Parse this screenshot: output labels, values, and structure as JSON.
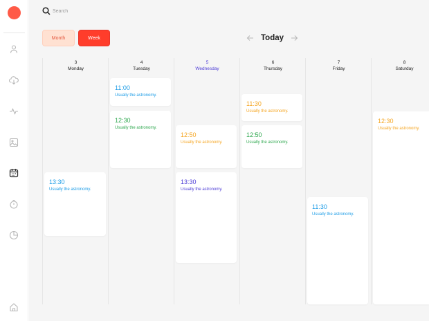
{
  "search": {
    "placeholder": "Search"
  },
  "toolbar": {
    "month_label": "Month",
    "week_label": "Week"
  },
  "nav": {
    "today_label": "Today"
  },
  "sidebar": {
    "icons": [
      "user-icon",
      "cloud-download-icon",
      "activity-icon",
      "image-icon",
      "calendar-icon",
      "timer-icon",
      "pie-chart-icon",
      "home-icon"
    ],
    "active": "calendar-icon"
  },
  "colors": {
    "brand": "#ff5a47",
    "blue": "#1a9be6",
    "green": "#2fa84f",
    "orange": "#f5a623",
    "purple": "#4c3bd6"
  },
  "days": [
    {
      "num": "3",
      "name": "Monday",
      "current": false
    },
    {
      "num": "4",
      "name": "Tuesday",
      "current": false
    },
    {
      "num": "5",
      "name": "Wednesday",
      "current": true
    },
    {
      "num": "6",
      "name": "Thursday",
      "current": false
    },
    {
      "num": "7",
      "name": "Friday",
      "current": false
    },
    {
      "num": "8",
      "name": "Saturday",
      "current": false
    }
  ],
  "events": [
    {
      "day": 0,
      "time": "13:30",
      "desc": "Usually the astronomy.",
      "color": "#1a9be6"
    },
    {
      "day": 1,
      "time": "11:00",
      "desc": "Usually the astronomy.",
      "color": "#1a9be6"
    },
    {
      "day": 1,
      "time": "12:30",
      "desc": "Usually the astronomy.",
      "color": "#2fa84f"
    },
    {
      "day": 2,
      "time": "12:50",
      "desc": "Usually the astronomy.",
      "color": "#f5a623"
    },
    {
      "day": 2,
      "time": "13:30",
      "desc": "Usually the astronomy.",
      "color": "#4c3bd6"
    },
    {
      "day": 3,
      "time": "11:30",
      "desc": "Usually the astronomy.",
      "color": "#f5a623"
    },
    {
      "day": 3,
      "time": "12:50",
      "desc": "Usually the astronomy.",
      "color": "#2fa84f"
    },
    {
      "day": 4,
      "time": "11:30",
      "desc": "Usually the astronomy.",
      "color": "#1a9be6"
    },
    {
      "day": 5,
      "time": "12:30",
      "desc": "Usually the astronomy.",
      "color": "#f5a623"
    }
  ]
}
